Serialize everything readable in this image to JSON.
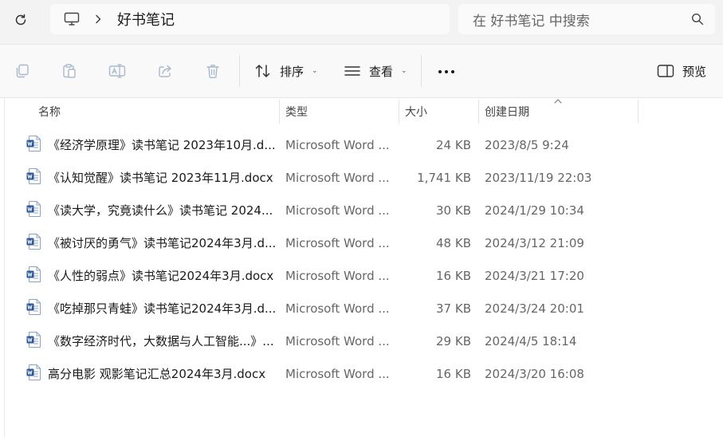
{
  "address": {
    "crumb": "好书笔记"
  },
  "search": {
    "placeholder": "在 好书笔记 中搜索"
  },
  "toolbar": {
    "sort_label": "排序",
    "view_label": "查看",
    "preview_label": "预览"
  },
  "columns": {
    "name": "名称",
    "type": "类型",
    "size": "大小",
    "date": "创建日期"
  },
  "files": [
    {
      "name": "《经济学原理》读书笔记 2023年10月.d...",
      "type": "Microsoft Word ...",
      "size": "24 KB",
      "date": "2023/8/5 9:24"
    },
    {
      "name": "《认知觉醒》读书笔记 2023年11月.docx",
      "type": "Microsoft Word ...",
      "size": "1,741 KB",
      "date": "2023/11/19 22:03"
    },
    {
      "name": "《读大学，究竟读什么》读书笔记 2024...",
      "type": "Microsoft Word ...",
      "size": "30 KB",
      "date": "2024/1/29 10:34"
    },
    {
      "name": "《被讨厌的勇气》读书笔记2024年3月.d...",
      "type": "Microsoft Word ...",
      "size": "48 KB",
      "date": "2024/3/12 21:09"
    },
    {
      "name": "《人性的弱点》读书笔记2024年3月.docx",
      "type": "Microsoft Word ...",
      "size": "16 KB",
      "date": "2024/3/21 17:20"
    },
    {
      "name": "《吃掉那只青蛙》读书笔记2024年3月.d...",
      "type": "Microsoft Word ...",
      "size": "37 KB",
      "date": "2024/3/24 20:01"
    },
    {
      "name": "《数字经济时代，大数据与人工智能...》...",
      "type": "Microsoft Word ...",
      "size": "29 KB",
      "date": "2024/4/5 18:14"
    },
    {
      "name": "高分电影 观影笔记汇总2024年3月.docx",
      "type": "Microsoft Word ...",
      "size": "16 KB",
      "date": "2024/3/20 16:08"
    }
  ],
  "icons": {
    "refresh": "refresh-icon",
    "computer": "computer-icon",
    "search": "search-icon",
    "copy": "copy-icon",
    "paste": "paste-icon",
    "rename": "rename-icon",
    "share": "share-icon",
    "delete": "delete-icon",
    "sort": "sort-icon",
    "view": "view-icon",
    "more": "more-icon",
    "preview": "preview-pane-icon",
    "word": "word-document-icon"
  },
  "colors": {
    "word_blue": "#2b579a",
    "toolbar_bg": "#f9f9f9",
    "topbar_bg": "#f3f3f3"
  }
}
